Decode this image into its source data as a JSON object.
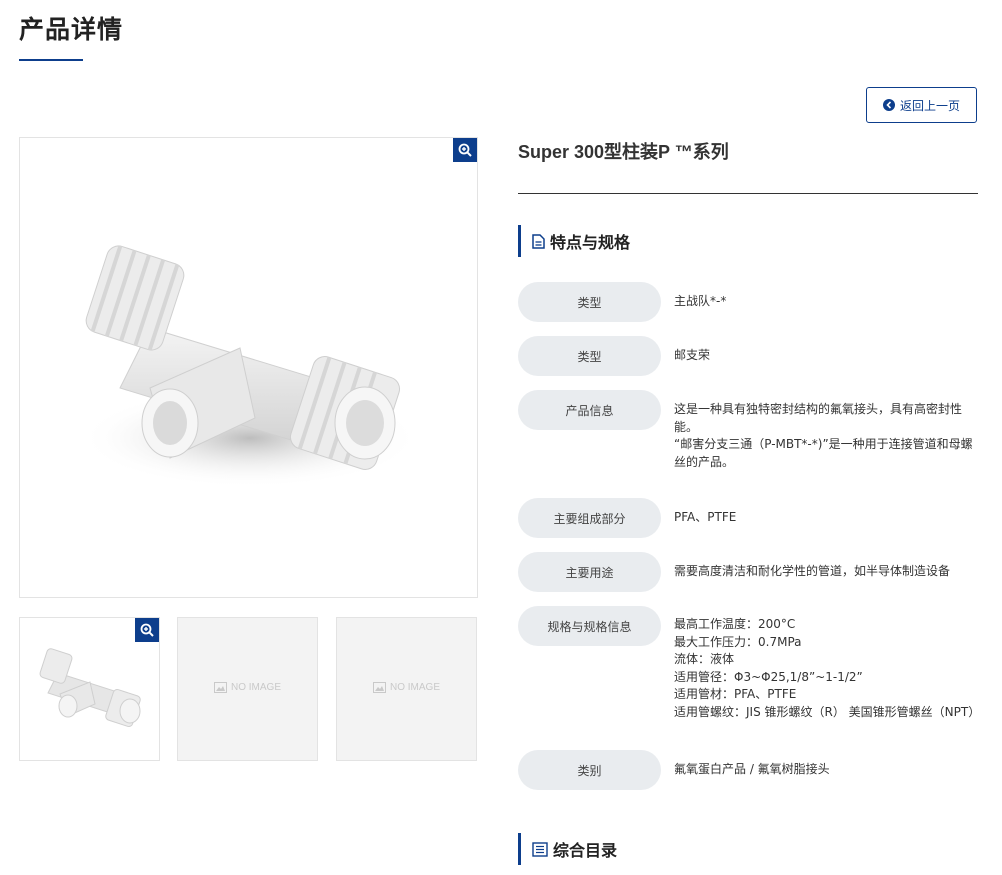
{
  "page": {
    "title": "产品详情",
    "back_label": "返回上一页"
  },
  "product": {
    "name": "Super 300型柱装P ™系列",
    "thumbnails": [
      {
        "kind": "image"
      },
      {
        "kind": "placeholder",
        "text": "NO IMAGE"
      },
      {
        "kind": "placeholder",
        "text": "NO IMAGE"
      }
    ]
  },
  "features": {
    "heading": "特点与规格",
    "rows": [
      {
        "label": "类型",
        "value": "主战队*-*"
      },
      {
        "label": "类型",
        "value": "邮支荣"
      },
      {
        "label": "产品信息",
        "value": "这是一种具有独特密封结构的氟氧接头，具有高密封性能。\n“邮害分支三通（P-MBT*-*)”是一种用于连接管道和母螺丝的产品。"
      },
      {
        "label": "主要组成部分",
        "value": "PFA、PTFE"
      },
      {
        "label": "主要用途",
        "value": "需要高度清洁和耐化学性的管道，如半导体制造设备"
      },
      {
        "label": "规格与规格信息",
        "value": "最高工作温度：200°C\n最大工作压力：0.7MPa\n流体：液体\n适用管径：Φ3~Φ25,1/8”~1-1/2”\n适用管材：PFA、PTFE\n适用管螺纹：JIS 锥形螺纹（R） 美国锥形管螺丝（NPT）"
      },
      {
        "label": "类别",
        "value": "氟氧蛋白产品 / 氟氧树脂接头"
      }
    ]
  },
  "catalog": {
    "heading": "综合目录"
  },
  "colors": {
    "accent": "#0d3e8c",
    "label_bg": "#e9ecef"
  }
}
